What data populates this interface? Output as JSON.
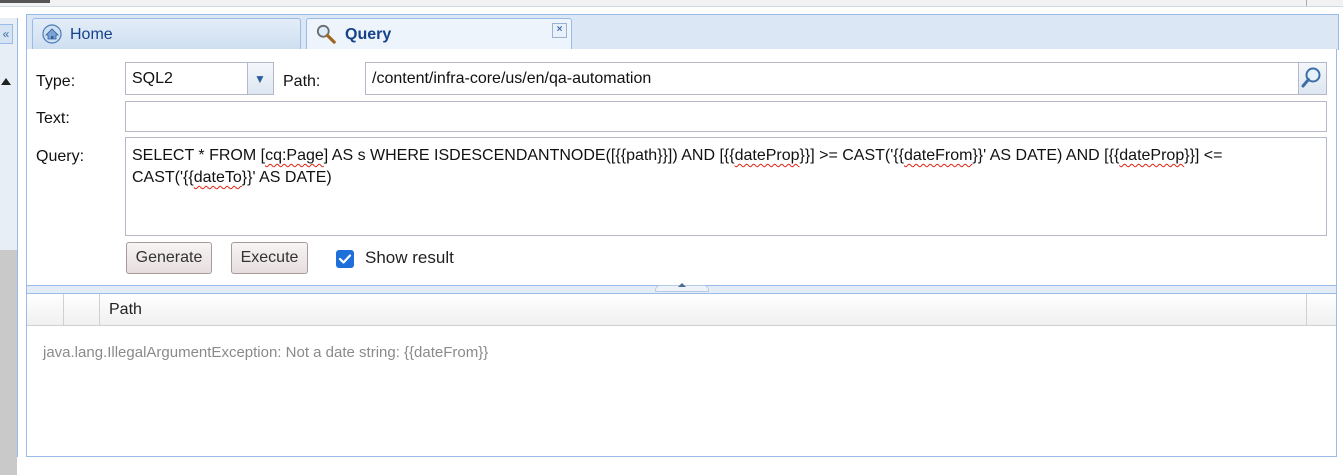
{
  "tabs": [
    {
      "label": "Home",
      "icon": "home-icon"
    },
    {
      "label": "Query",
      "icon": "search-icon",
      "closable": true
    }
  ],
  "form": {
    "type_label": "Type:",
    "type_value": "SQL2",
    "path_label": "Path:",
    "path_value": "/content/infra-core/us/en/qa-automation",
    "text_label": "Text:",
    "text_value": "",
    "query_label": "Query:",
    "query_value": "SELECT * FROM [cq:Page] AS s WHERE ISDESCENDANTNODE([{{path}}]) AND [{{dateProp}}] >= CAST('{{dateFrom}}' AS DATE) AND [{{dateProp}}] <= CAST('{{dateTo}}' AS DATE)"
  },
  "actions": {
    "generate_label": "Generate",
    "execute_label": "Execute",
    "show_result_label": "Show result",
    "show_result_checked": true
  },
  "results": {
    "columns": [
      "",
      "",
      "Path"
    ],
    "message": "java.lang.IllegalArgumentException: Not a date string: {{dateFrom}}"
  },
  "colors": {
    "tab_text": "#15428b",
    "panel_border": "#99bbe8",
    "checkbox": "#1e6fd9"
  }
}
